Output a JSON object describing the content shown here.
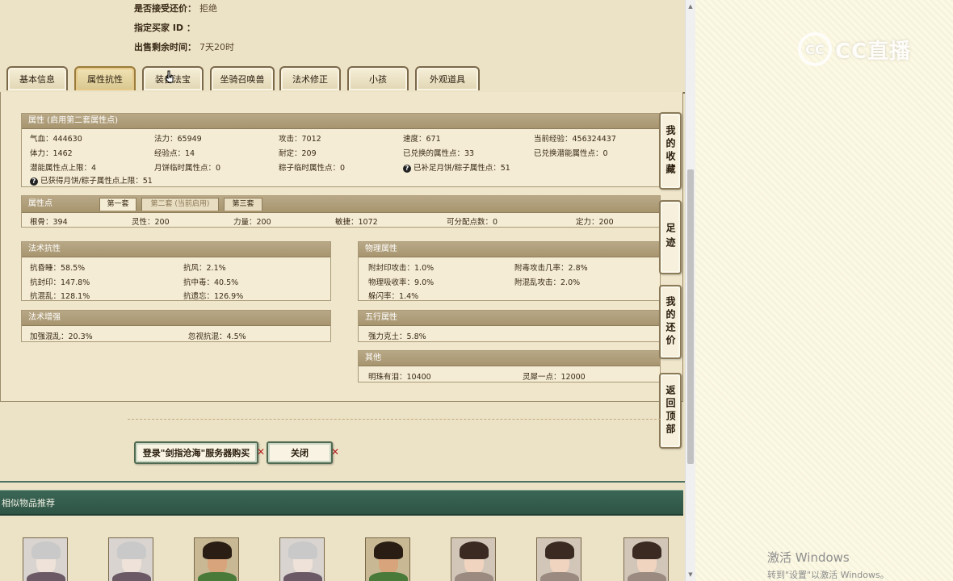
{
  "sale_info": {
    "accept_counter_label": "是否接受还价：",
    "accept_counter_value": "拒绝",
    "buyer_id_label": "指定买家 ID ：",
    "buyer_id_value": "",
    "remaining_label": "出售剩余时间：",
    "remaining_value": "7天20时"
  },
  "tabs": [
    {
      "label": "基本信息"
    },
    {
      "label": "属性抗性",
      "active": true
    },
    {
      "label": "装备法宝"
    },
    {
      "label": "坐骑召唤兽"
    },
    {
      "label": "法术修正"
    },
    {
      "label": "小孩"
    },
    {
      "label": "外观道具"
    }
  ],
  "attributes": {
    "title": "属性 (启用第二套属性点)",
    "cells": [
      "气血：444630",
      "法力：65949",
      "攻击：7012",
      "速度：671",
      "当前经验：456324437",
      "体力：1462",
      "经验点：14",
      "耐定：209",
      "已兑换的属性点：33",
      "已兑换潜能属性点：0",
      "潜能属性点上限：4",
      "月饼临时属性点：0",
      "粽子临时属性点：0",
      "已补足月饼/粽子属性点：51",
      "已获得月饼/粽子属性点上限：51"
    ]
  },
  "points": {
    "title": "属性点",
    "subtabs": [
      {
        "label": "第一套",
        "active": true
      },
      {
        "label": "第二套 (当前启用)"
      },
      {
        "label": "第三套"
      }
    ],
    "cells": [
      "根骨：394",
      "灵性：200",
      "力量：200",
      "敏捷：1072",
      "可分配点数：0",
      "定力：200"
    ]
  },
  "magic_resist": {
    "title": "法术抗性",
    "cells": [
      "抗昏睡：58.5%",
      "抗风：2.1%",
      "抗封印：147.8%",
      "抗中毒：40.5%",
      "抗混乱：128.1%",
      "抗遗忘：126.9%"
    ]
  },
  "magic_boost": {
    "title": "法术增强",
    "cells": [
      "加强混乱：20.3%",
      "忽视抗混：4.5%"
    ]
  },
  "physical": {
    "title": "物理属性",
    "cells": [
      "附封印攻击：1.0%",
      "附毒攻击几率：2.8%",
      "物理吸收率：9.0%",
      "附混乱攻击：2.0%",
      "躲闪率：1.4%"
    ]
  },
  "five_elements": {
    "title": "五行属性",
    "cells": [
      "强力克土：5.8%"
    ]
  },
  "other": {
    "title": "其他",
    "cells": [
      "明珠有泪：10400",
      "灵犀一点：12000"
    ]
  },
  "side_tabs": [
    {
      "label": "我的收藏"
    },
    {
      "label": "足迹"
    },
    {
      "label": "我的还价"
    },
    {
      "label": "返回顶部"
    }
  ],
  "buttons": {
    "login_buy": "登录\"剑指沧海\"服务器购买",
    "close": "关闭",
    "x_mark": "✕"
  },
  "similar": {
    "title": "相似物品推荐"
  },
  "watermark": {
    "logo": "CC",
    "text": "CC直播"
  },
  "windows": {
    "activate_title": "激活 Windows",
    "activate_sub": "转到\"设置\"以激活 Windows。"
  },
  "colors": {
    "header_green": "#2e5445",
    "box_head": "#a7956f",
    "active_tab": "#d8c78e"
  }
}
